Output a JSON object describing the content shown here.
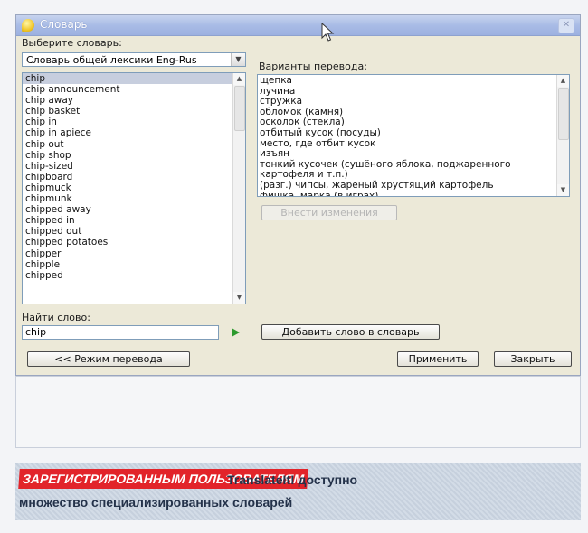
{
  "window": {
    "title": "Словарь",
    "close_icon": "close-icon"
  },
  "labels": {
    "choose_dict": "Выберите словарь:",
    "variants": "Варианты перевода:",
    "find_word": "Найти слово:"
  },
  "dict_select": {
    "value": "Словарь общей лексики Eng-Rus"
  },
  "word_list": {
    "selected_index": 0,
    "items": [
      "chip",
      "chip announcement",
      "chip away",
      "chip basket",
      "chip in",
      "chip in apiece",
      "chip out",
      "chip shop",
      "chip-sized",
      "chipboard",
      "chipmuck",
      "chipmunk",
      "chipped away",
      "chipped in",
      "chipped out",
      "chipped potatoes",
      "chipper",
      "chipple",
      "chipped"
    ]
  },
  "translations": [
    "щепка",
    "лучина",
    "стружка",
    "обломок (камня)",
    "осколок (стекла)",
    "отбитый кусок (посуды)",
    "место, где отбит кусок",
    "изъян",
    "тонкий кусочек (сушёного яблока, поджаренного",
    "картофеля и т.п.)",
    "(разг.) чипсы, жареный хрустящий картофель",
    "фишка, марка (в играх)"
  ],
  "buttons": {
    "apply_changes": "Внести изменения",
    "add_word": "Добавить слово в словарь",
    "translate_mode": "<< Режим перевода",
    "apply": "Применить",
    "close": "Закрыть"
  },
  "search": {
    "value": "chip"
  },
  "banner": {
    "tag": "ЗАРЕГИСТРИРОВАННЫМ ПОЛЬЗОВАТЕЛЯМ",
    "line1": "TranslateIt! доступно",
    "line2": "множество специализированных словарей",
    "tag_color": "#e2242a"
  }
}
